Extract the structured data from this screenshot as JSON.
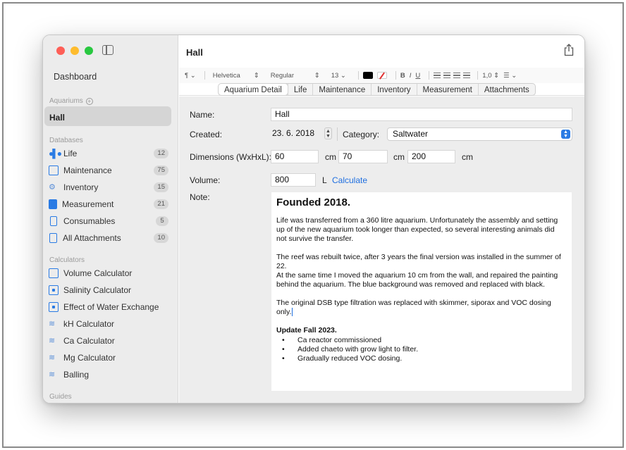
{
  "sidebar": {
    "dashboard": "Dashboard",
    "aquariums_header": "Aquariums",
    "selected_aquarium": "Hall",
    "databases_header": "Databases",
    "databases": [
      {
        "label": "Life",
        "count": "12",
        "icon": "fish-icon"
      },
      {
        "label": "Maintenance",
        "count": "75",
        "icon": "calendar-icon"
      },
      {
        "label": "Inventory",
        "count": "15",
        "icon": "gears-icon"
      },
      {
        "label": "Measurement",
        "count": "21",
        "icon": "test-tubes-icon"
      },
      {
        "label": "Consumables",
        "count": "5",
        "icon": "bottle-icon"
      },
      {
        "label": "All Attachments",
        "count": "10",
        "icon": "document-icon"
      }
    ],
    "calculators_header": "Calculators",
    "calculators": [
      {
        "label": "Volume Calculator",
        "icon": "square-icon"
      },
      {
        "label": "Salinity Calculator",
        "icon": "dot-square-icon"
      },
      {
        "label": "Effect of Water Exchange",
        "icon": "dot-square-icon"
      },
      {
        "label": "kH Calculator",
        "icon": "wave-icon"
      },
      {
        "label": "Ca Calculator",
        "icon": "wave-icon"
      },
      {
        "label": "Mg Calculator",
        "icon": "wave-icon"
      },
      {
        "label": "Balling",
        "icon": "wave-icon"
      }
    ],
    "guides_header": "Guides"
  },
  "window": {
    "title": "Hall"
  },
  "toolbar": {
    "paragraph": "¶",
    "font_family": "Helvetica",
    "font_style": "Regular",
    "font_size": "13",
    "bold": "B",
    "italic": "I",
    "underline": "U",
    "line_spacing": "1,0",
    "text_color": "#000000"
  },
  "tabs": [
    "Aquarium Detail",
    "Life",
    "Maintenance",
    "Inventory",
    "Measurement",
    "Attachments"
  ],
  "form": {
    "name_label": "Name:",
    "name_value": "Hall",
    "created_label": "Created:",
    "created_value": "23.  6. 2018",
    "category_label": "Category:",
    "category_value": "Saltwater",
    "dimensions_label": "Dimensions (WxHxL):",
    "width": "60",
    "height": "70",
    "length": "200",
    "dim_unit": "cm",
    "volume_label": "Volume:",
    "volume_value": "800",
    "volume_unit": "L",
    "calculate_link": "Calculate",
    "note_label": "Note:"
  },
  "note": {
    "heading": "Founded 2018.",
    "p1": "Life was transferred from a 360 litre aquarium. Unfortunately the assembly and setting up of the new aquarium took longer than expected, so several interesting animals did not survive the transfer.",
    "p2a": "The reef was rebuilt twice, after 3 years the final version was installed in the summer of 22.",
    "p2b": "At the same time I moved the aquarium 10 cm from the wall, and repaired the painting behind the aquarium. The blue background was removed and replaced with black.",
    "p3": "The original DSB type filtration was replaced with skimmer, siporax and VOC dosing only.",
    "update_heading": "Update Fall 2023.",
    "bullets": [
      "Ca reactor commissioned",
      "Added chaeto with grow light to filter.",
      "Gradually reduced VOC dosing."
    ]
  },
  "colors": {
    "accent": "#2a7be4",
    "link": "#1f6fe0",
    "sidebar_bg": "#ececec",
    "selected_bg": "#d5d5d5"
  }
}
